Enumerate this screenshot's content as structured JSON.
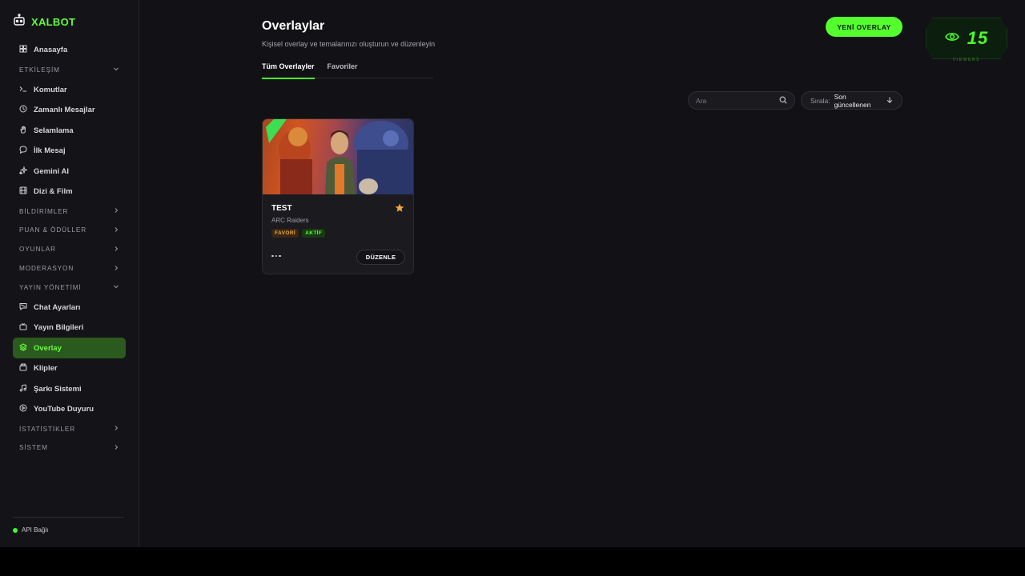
{
  "brand": {
    "name": "XALBOT",
    "icon": "robot-icon"
  },
  "sidebar": {
    "items": [
      {
        "type": "item",
        "label": "Anasayfa",
        "icon": "grid-icon"
      },
      {
        "type": "section",
        "label": "ETKİLEŞİM",
        "expanded": true
      },
      {
        "type": "item",
        "label": "Komutlar",
        "icon": "terminal-icon"
      },
      {
        "type": "item",
        "label": "Zamanlı Mesajlar",
        "icon": "clock-icon"
      },
      {
        "type": "item",
        "label": "Selamlama",
        "icon": "hand-icon"
      },
      {
        "type": "item",
        "label": "İlk Mesaj",
        "icon": "message-icon"
      },
      {
        "type": "item",
        "label": "Gemini AI",
        "icon": "sparkles-icon"
      },
      {
        "type": "item",
        "label": "Dizi & Film",
        "icon": "film-icon"
      },
      {
        "type": "section",
        "label": "BİLDİRİMLER",
        "expanded": false
      },
      {
        "type": "section",
        "label": "PUAN & ÖDÜLLER",
        "expanded": false
      },
      {
        "type": "section",
        "label": "OYUNLAR",
        "expanded": false
      },
      {
        "type": "section",
        "label": "MODERASYON",
        "expanded": false
      },
      {
        "type": "section",
        "label": "YAYIN YÖNETİMİ",
        "expanded": true
      },
      {
        "type": "item",
        "label": "Chat Ayarları",
        "icon": "chat-settings-icon"
      },
      {
        "type": "item",
        "label": "Yayın Bilgileri",
        "icon": "tv-icon"
      },
      {
        "type": "item",
        "label": "Overlay",
        "icon": "layers-icon",
        "active": true
      },
      {
        "type": "item",
        "label": "Klipler",
        "icon": "clip-icon"
      },
      {
        "type": "item",
        "label": "Şarkı Sistemi",
        "icon": "music-icon"
      },
      {
        "type": "item",
        "label": "YouTube Duyuru",
        "icon": "youtube-icon"
      },
      {
        "type": "section",
        "label": "İSTATİSTİKLER",
        "expanded": false
      },
      {
        "type": "section",
        "label": "SİSTEM",
        "expanded": false
      }
    ],
    "api_status": "API Bağlı"
  },
  "header": {
    "title": "Overlaylar",
    "subtitle": "Kişisel overlay ve temalarınızı oluşturun ve düzenleyin",
    "new_button": "YENİ OVERLAY"
  },
  "tabs": [
    {
      "label": "Tüm Overlayler",
      "active": true
    },
    {
      "label": "Favoriler",
      "active": false
    }
  ],
  "viewers": {
    "count": "15",
    "label": "VIEWERS"
  },
  "search": {
    "placeholder": "Ara",
    "value": ""
  },
  "sort": {
    "label": "Sırala:",
    "value": "Son güncellenen"
  },
  "cards": [
    {
      "title": "TEST",
      "subtitle": "ARC Raiders",
      "favorite": true,
      "badges": [
        "FAVORİ",
        "AKTİF"
      ],
      "edit_label": "DÜZENLE"
    }
  ],
  "colors": {
    "accent": "#55ff2e",
    "favorite": "#f0a640",
    "active_nav_bg": "#2a5a1d"
  }
}
